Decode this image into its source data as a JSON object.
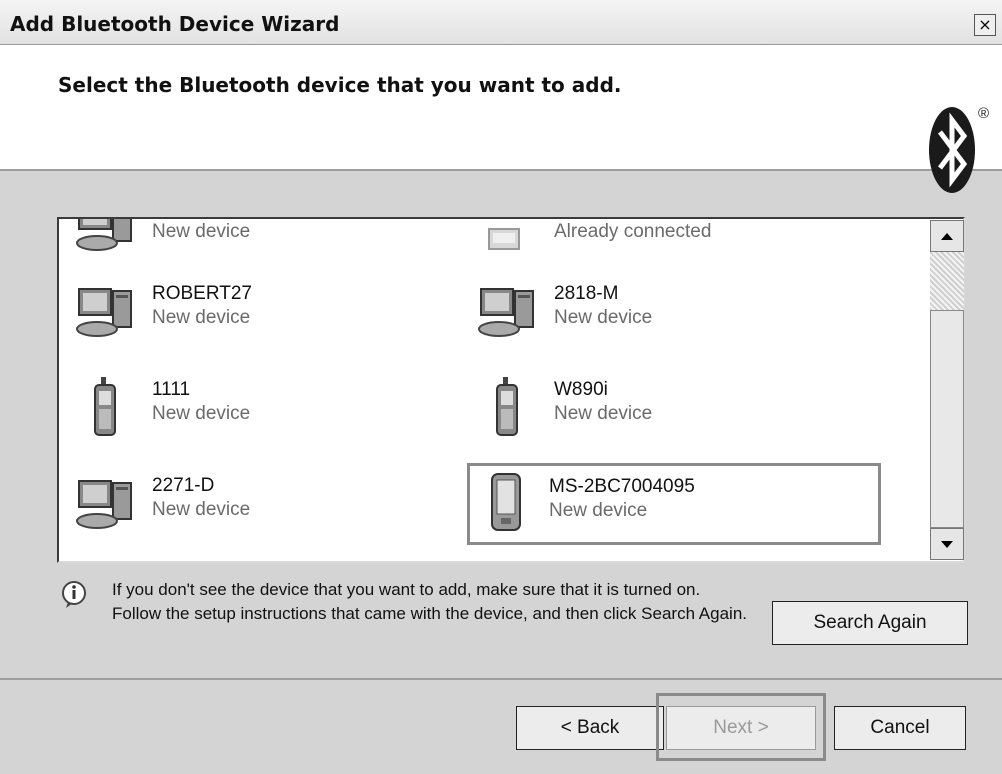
{
  "window": {
    "title": "Add Bluetooth Device Wizard",
    "close_label": "×"
  },
  "header": {
    "title": "Select the Bluetooth device that you want to add.",
    "reg_mark": "®"
  },
  "devices": [
    {
      "name": "",
      "status": "New device",
      "icon": "computer-icon"
    },
    {
      "name": "",
      "status": "Already connected",
      "icon": "printer-icon"
    },
    {
      "name": "ROBERT27",
      "status": "New device",
      "icon": "computer-icon"
    },
    {
      "name": "2818-M",
      "status": "New device",
      "icon": "computer-icon"
    },
    {
      "name": "1111",
      "status": "New device",
      "icon": "phone-icon"
    },
    {
      "name": "W890i",
      "status": "New device",
      "icon": "phone-icon"
    },
    {
      "name": "2271-D",
      "status": "New device",
      "icon": "computer-icon"
    },
    {
      "name": "MS-2BC7004095",
      "status": "New device",
      "icon": "pda-icon",
      "selected": true
    }
  ],
  "info": {
    "text": "If you don't see the device that you want to add, make sure that it is turned on. Follow the setup instructions that came with the device, and then click Search Again."
  },
  "buttons": {
    "search_again": "Search Again",
    "back": "< Back",
    "next": "Next >",
    "cancel": "Cancel"
  }
}
